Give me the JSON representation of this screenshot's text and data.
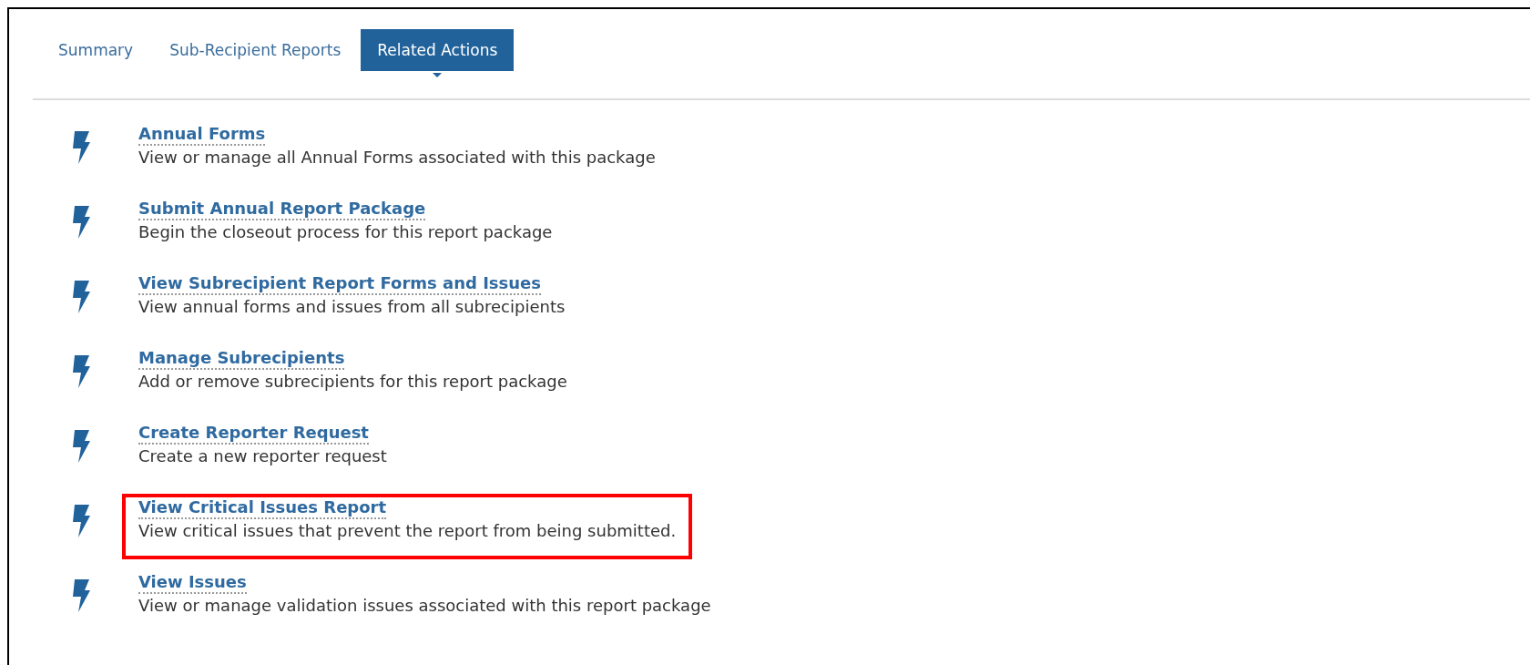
{
  "tabs": [
    {
      "label": "Summary",
      "selected": false
    },
    {
      "label": "Sub-Recipient Reports",
      "selected": false
    },
    {
      "label": "Related Actions",
      "selected": true
    }
  ],
  "actions": [
    {
      "title": "Annual Forms",
      "description": "View or manage all Annual Forms associated with this package",
      "highlighted": false
    },
    {
      "title": "Submit Annual Report Package",
      "description": "Begin the closeout process for this report package",
      "highlighted": false
    },
    {
      "title": "View Subrecipient Report Forms and Issues",
      "description": "View annual forms and issues from all subrecipients",
      "highlighted": false
    },
    {
      "title": "Manage Subrecipients",
      "description": "Add or remove subrecipients for this report package",
      "highlighted": false
    },
    {
      "title": "Create Reporter Request",
      "description": "Create a new reporter request",
      "highlighted": false
    },
    {
      "title": "View Critical Issues Report",
      "description": "View critical issues that prevent the report from being submitted.",
      "highlighted": true
    },
    {
      "title": "View Issues",
      "description": "View or manage validation issues associated with this report package",
      "highlighted": false
    }
  ]
}
